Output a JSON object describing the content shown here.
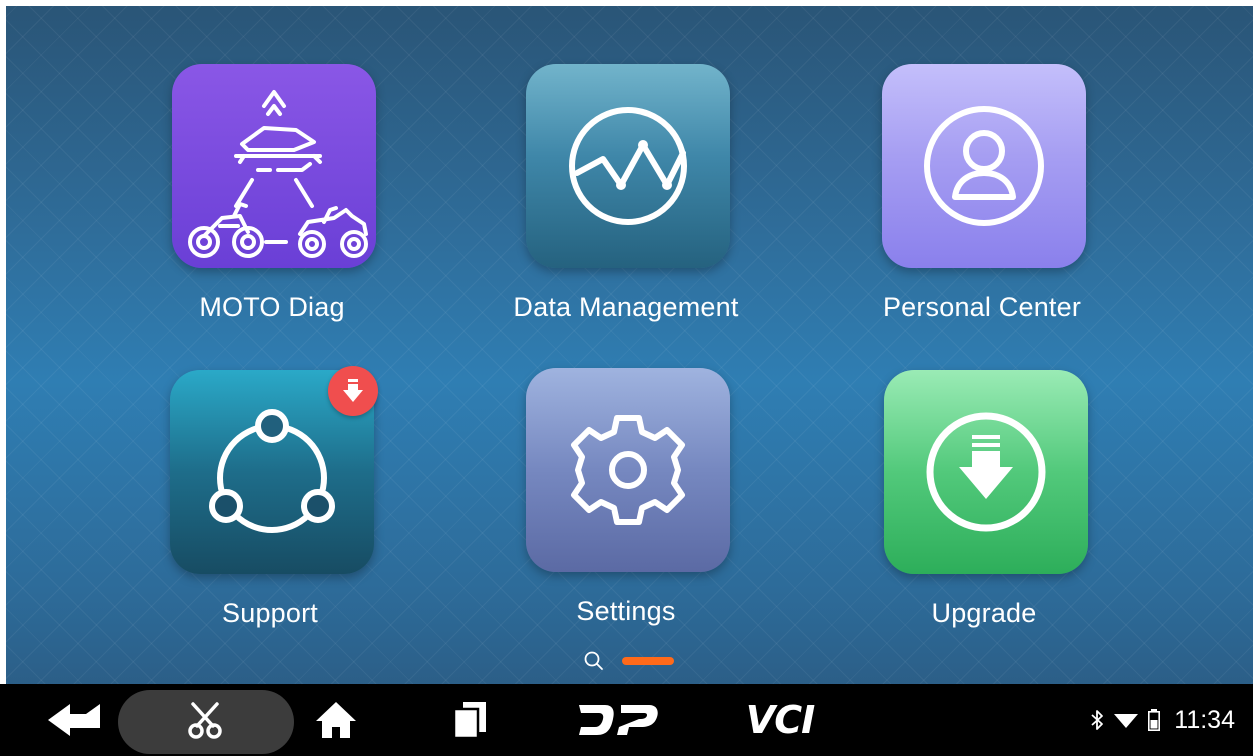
{
  "apps": [
    {
      "label": "MOTO Diag",
      "icon": "moto-diag-icon"
    },
    {
      "label": "Data Management",
      "icon": "line-chart-icon"
    },
    {
      "label": "Personal Center",
      "icon": "person-icon"
    },
    {
      "label": "Support",
      "icon": "share-nodes-icon",
      "badge": "download-badge-icon"
    },
    {
      "label": "Settings",
      "icon": "gear-icon"
    },
    {
      "label": "Upgrade",
      "icon": "download-arrow-icon"
    }
  ],
  "pager": {
    "pages": 2,
    "active_page": 2
  },
  "navbar": {
    "buttons": [
      "back-icon",
      "scissors-icon",
      "home-icon",
      "recent-apps-icon",
      "dp-logo",
      "vci-logo"
    ],
    "dp_text": "DP",
    "vci_text": "VCI"
  },
  "status_bar": {
    "icons": [
      "bluetooth-icon",
      "wifi-icon",
      "battery-icon"
    ],
    "time": "11:34"
  },
  "colors": {
    "accent": "#ff6a1a",
    "badge": "#f04e4e",
    "navbar": "#000000"
  }
}
